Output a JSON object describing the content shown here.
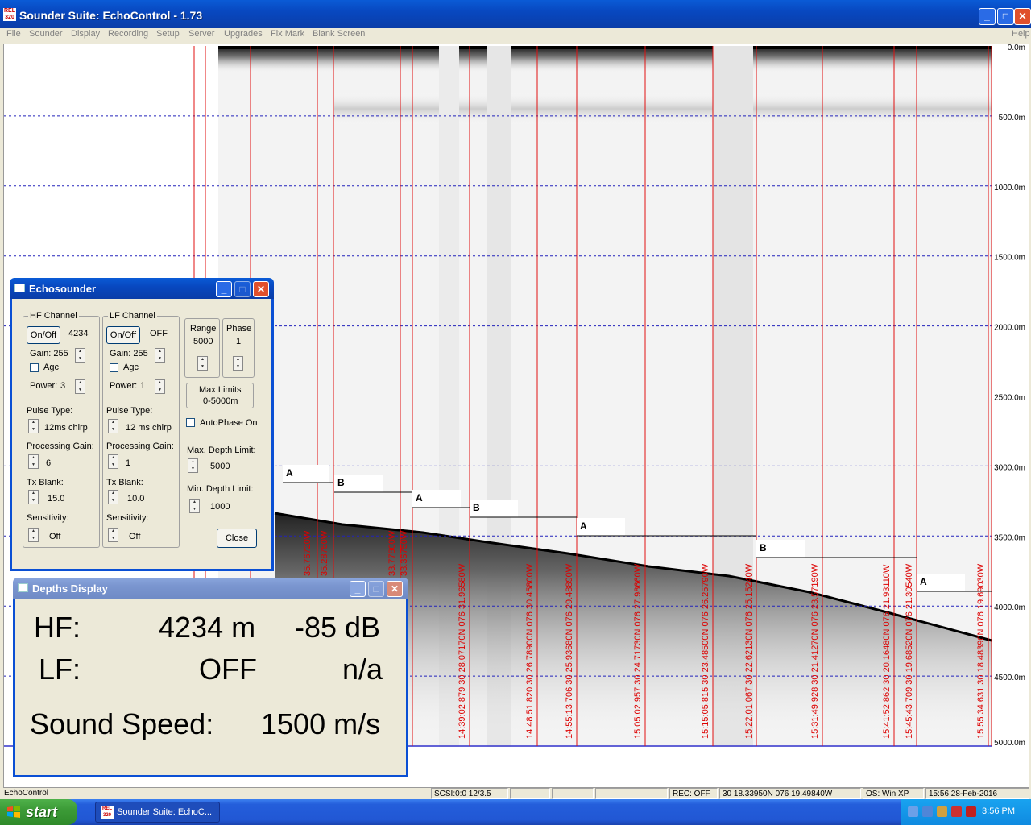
{
  "app": {
    "title": "Sounder Suite: EchoControl - 1.73",
    "icon_text": "REL 320",
    "controls": [
      "_",
      "□",
      "✕"
    ]
  },
  "menu": {
    "items": [
      "File",
      "Sounder",
      "Display",
      "Recording",
      "Setup",
      "Server",
      "Upgrades",
      "Fix Mark",
      "Blank Screen"
    ],
    "help": "Help"
  },
  "echogram": {
    "depth_labels": [
      "0.0m",
      "500.0m",
      "1000.0m",
      "1500.0m",
      "2000.0m",
      "2500.0m",
      "3000.0m",
      "3500.0m",
      "4000.0m",
      "4500.0m",
      "5000.0m"
    ],
    "fix_labels": [
      {
        "lat": "30 28.07170N",
        "lon": "076 31.96580W",
        "time": "14:39:02.879"
      },
      {
        "lat": "30 26.78900N",
        "lon": "076 30.45800W",
        "time": "14:48:51.820"
      },
      {
        "lat": "30 25.93680N",
        "lon": "076 29.48890W",
        "time": "14:55:13.706"
      },
      {
        "lat": "30 24.71730N",
        "lon": "076 27.98660W",
        "time": "15:05:02.957"
      },
      {
        "lat": "30 23.48500N",
        "lon": "076 26.25790W",
        "time": "15:15:05.815"
      },
      {
        "lat": "30 22.62130N",
        "lon": "076 25.15240W",
        "time": "15:22:01.067"
      },
      {
        "lat": "30 21.41270N",
        "lon": "076 23.57190W",
        "time": "15:31:49.928"
      },
      {
        "lat": "30 20.16480N",
        "lon": "076 21.93110W",
        "time": "15:41:52.862"
      },
      {
        "lat": "30 19.68520N",
        "lon": "076 21.30540W",
        "time": "15:45:43.709"
      },
      {
        "lat": "30 18.48390N",
        "lon": "076 19.69030W",
        "time": "15:55:34.631"
      }
    ],
    "partial_fix_labels": [
      "35.76720W",
      "35.28750W",
      "33.77800W",
      "33.36750W"
    ],
    "segment_marks": [
      "A",
      "B",
      "A",
      "B",
      "A",
      "B",
      "A"
    ]
  },
  "echosounder": {
    "title": "Echosounder",
    "hf": {
      "group": "HF Channel",
      "onoff": "On/Off",
      "value": "4234",
      "gain": "Gain: 255",
      "agc": "Agc",
      "power_label": "Power:",
      "power": "3",
      "pulse_label": "Pulse Type:",
      "pulse": "12ms chirp",
      "proc_label": "Processing Gain:",
      "proc": "6",
      "tx_label": "Tx Blank:",
      "tx": "15.0",
      "sens_label": "Sensitivity:",
      "sens": "Off"
    },
    "lf": {
      "group": "LF Channel",
      "onoff": "On/Off",
      "value": "OFF",
      "gain": "Gain: 255",
      "agc": "Agc",
      "power_label": "Power:",
      "power": "1",
      "pulse_label": "Pulse Type:",
      "pulse": "12 ms chirp",
      "proc_label": "Processing Gain:",
      "proc": "1",
      "tx_label": "Tx Blank:",
      "tx": "10.0",
      "sens_label": "Sensitivity:",
      "sens": "Off"
    },
    "range_label": "Range",
    "range": "5000",
    "phase_label": "Phase",
    "phase": "1",
    "max_limits_1": "Max Limits",
    "max_limits_2": "0-5000m",
    "autophase": "AutoPhase On",
    "max_depth_label": "Max. Depth Limit:",
    "max_depth": "5000",
    "min_depth_label": "Min. Depth Limit:",
    "min_depth": "1000",
    "close": "Close"
  },
  "depths": {
    "title": "Depths Display",
    "hf_label": "HF:",
    "hf_depth": "4234 m",
    "hf_db": "-85 dB",
    "lf_label": "LF:",
    "lf_depth": "OFF",
    "lf_db": "n/a",
    "ss_label": "Sound Speed:",
    "ss": "1500 m/s"
  },
  "status": {
    "left": "EchoControl",
    "scsi": "SCSI:0:0 12/3.5",
    "rec": "REC: OFF",
    "pos": "30 18.33950N 076 19.49840W",
    "os": "OS: Win XP",
    "datetime": "15:56 28-Feb-2016"
  },
  "taskbar": {
    "start": "start",
    "item": "Sounder Suite: EchoC...",
    "clock": "3:56 PM"
  }
}
